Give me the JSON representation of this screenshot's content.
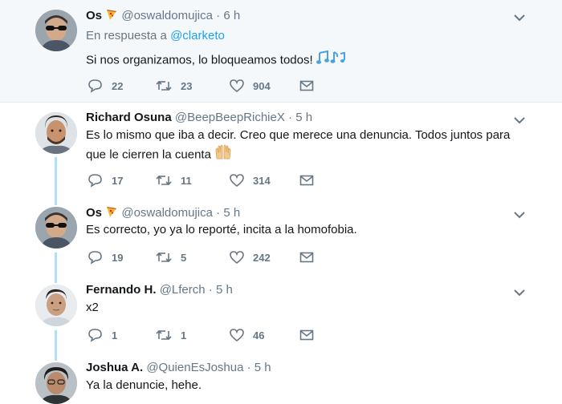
{
  "colors": {
    "accent": "#1da1f2",
    "thread_line": "#aee0f7",
    "muted": "#657786",
    "highlight_bg": "#f5f8fa"
  },
  "tweets": [
    {
      "name": "Os",
      "name_emoji": "pizza",
      "handle": "@oswaldomujica",
      "time": "6 h",
      "reply_prefix": "En respuesta a",
      "reply_mention": "@clarketo",
      "text": "Si nos organizamos, lo bloqueamos todos!",
      "text_emoji": "musical-notes",
      "replies": "22",
      "retweets": "23",
      "likes": "904"
    },
    {
      "name": "Richard Osuna",
      "handle": "@BeepBeepRichieX",
      "time": "5 h",
      "text_line1": "Es lo mismo que iba a decir. Creo que merece una denuncia. Todos juntos para",
      "text_line2": "que le cierren la cuenta",
      "text_emoji": "raised-hands",
      "replies": "17",
      "retweets": "11",
      "likes": "314"
    },
    {
      "name": "Os",
      "name_emoji": "pizza",
      "handle": "@oswaldomujica",
      "time": "5 h",
      "text": "Es correcto, yo ya lo reporté, incita a la homofobia.",
      "replies": "19",
      "retweets": "5",
      "likes": "242"
    },
    {
      "name": "Fernando H.",
      "handle": "@Lferch",
      "time": "5 h",
      "text": "x2",
      "replies": "1",
      "retweets": "1",
      "likes": "46"
    },
    {
      "name": "Joshua A.",
      "handle": "@QuienEsJoshua",
      "time": "5 h",
      "text": "Ya la denuncie, hehe."
    }
  ],
  "separator": "·"
}
